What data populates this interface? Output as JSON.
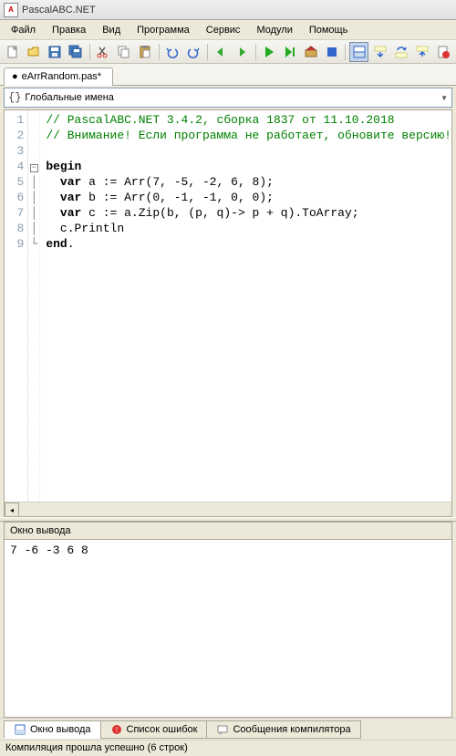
{
  "title": "PascalABC.NET",
  "menu": [
    "Файл",
    "Правка",
    "Вид",
    "Программа",
    "Сервис",
    "Модули",
    "Помощь"
  ],
  "tab": {
    "name": "eArrRandom.pas*",
    "modified": true
  },
  "nav_dropdown": "Глобальные имена",
  "code": {
    "lines": [
      "1",
      "2",
      "3",
      "4",
      "5",
      "6",
      "7",
      "8",
      "9"
    ],
    "l1": "// PascalABC.NET 3.4.2, сборка 1837 от 11.10.2018",
    "l2": "// Внимание! Если программа не работает, обновите версию!",
    "l3": "",
    "kw_begin": "begin",
    "kw_var": "var",
    "kw_end": "end",
    "l5_a": " a := Arr(7, -5, -2, 6, 8);",
    "l6_a": " b := Arr(0, -1, -1, 0, 0);",
    "l7_a": " c := a.Zip(b, (p, q)-> p + q).ToArray;",
    "l8": "  c.Println",
    "l9_dot": "."
  },
  "output": {
    "title": "Окно вывода",
    "text": "7 -6 -3 6 8"
  },
  "bottom_tabs": {
    "t1": "Окно вывода",
    "t2": "Список ошибок",
    "t3": "Сообщения компилятора"
  },
  "status": "Компиляция прошла успешно (6 строк)"
}
